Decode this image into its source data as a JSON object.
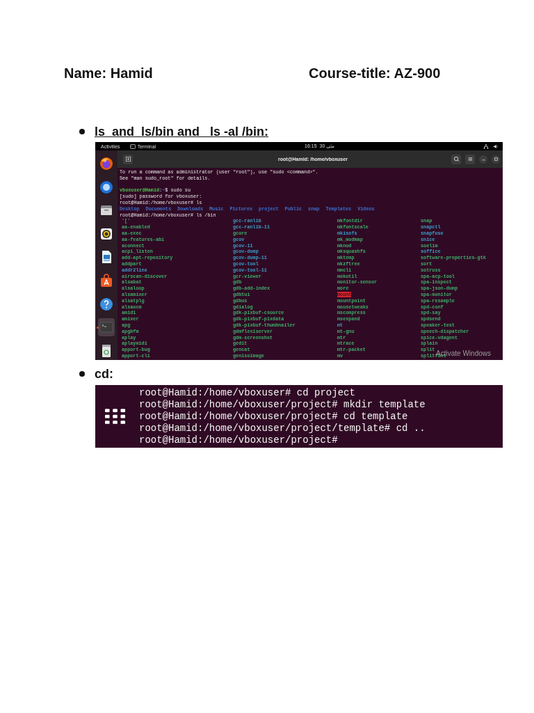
{
  "header": {
    "name": "Name: Hamid",
    "course": "Course-title: AZ-900"
  },
  "section_1": {
    "heading": "ls  and  ls/bin and   ls -al /bin:",
    "underlined": true,
    "desktop": {
      "topbar": {
        "activities": "Activities",
        "app": "Terminal",
        "time": "16:15",
        "date": "30 مئی"
      },
      "dock": [
        {
          "kind": "browser",
          "running": false
        },
        {
          "kind": "mail",
          "running": false
        },
        {
          "kind": "files",
          "running": false
        },
        {
          "kind": "music",
          "running": false
        },
        {
          "kind": "writer",
          "running": false
        },
        {
          "kind": "store",
          "running": false
        },
        {
          "kind": "help",
          "running": false
        },
        {
          "kind": "terminal",
          "running": true
        },
        {
          "kind": "trash",
          "running": false
        }
      ],
      "terminal": {
        "title": "root@Hamid: /home/vboxuser",
        "lines": [
          {
            "kind": "text",
            "segments": [
              {
                "t": "To run a command as administrator (user \"root\"), use \"sudo <command>\".",
                "kind": "plain"
              }
            ]
          },
          {
            "kind": "text",
            "segments": [
              {
                "t": "See \"man sudo_root\" for details.",
                "kind": "plain"
              }
            ]
          },
          {
            "kind": "blank"
          },
          {
            "kind": "text",
            "segments": [
              {
                "t": "vboxuser@Hamid",
                "kind": "user"
              },
              {
                "t": ":",
                "kind": "plain"
              },
              {
                "t": "~",
                "kind": "path"
              },
              {
                "t": "$ sudo su",
                "kind": "plain"
              }
            ]
          },
          {
            "kind": "text",
            "segments": [
              {
                "t": "[sudo] password for vboxuser:",
                "kind": "plain"
              }
            ]
          },
          {
            "kind": "text",
            "segments": [
              {
                "t": "root@Hamid:/home/vboxuser# ls",
                "kind": "plain"
              }
            ]
          },
          {
            "kind": "text",
            "segments": [
              {
                "t": "Desktop",
                "kind": "dir"
              },
              {
                "t": "Documents",
                "kind": "dir"
              },
              {
                "t": "Downloads",
                "kind": "dir"
              },
              {
                "t": "Music",
                "kind": "dir"
              },
              {
                "t": "Pictures",
                "kind": "dir"
              },
              {
                "t": "project",
                "kind": "dir"
              },
              {
                "t": "Public",
                "kind": "dir"
              },
              {
                "t": "snap",
                "kind": "dir"
              },
              {
                "t": "Templates",
                "kind": "dir"
              },
              {
                "t": "Videos",
                "kind": "dir"
              }
            ]
          },
          {
            "kind": "text",
            "segments": [
              {
                "t": "root@Hamid:/home/vboxuser# ls /bin",
                "kind": "plain"
              }
            ]
          }
        ],
        "columns": [
          [
            {
              "t": "'['",
              "kind": "exec"
            },
            {
              "t": "aa-enabled",
              "kind": "exec"
            },
            {
              "t": "aa-exec",
              "kind": "exec"
            },
            {
              "t": "aa-features-abi",
              "kind": "exec"
            },
            {
              "t": "aconnect",
              "kind": "exec"
            },
            {
              "t": "acpi_listen",
              "kind": "exec"
            },
            {
              "t": "add-apt-repository",
              "kind": "exec"
            },
            {
              "t": "addpart",
              "kind": "exec"
            },
            {
              "t": "addr2line",
              "kind": "link"
            },
            {
              "t": "airscan-discover",
              "kind": "exec"
            },
            {
              "t": "alsabat",
              "kind": "exec"
            },
            {
              "t": "alsaloop",
              "kind": "exec"
            },
            {
              "t": "alsamixer",
              "kind": "exec"
            },
            {
              "t": "alsatplg",
              "kind": "exec"
            },
            {
              "t": "alsaucm",
              "kind": "exec"
            },
            {
              "t": "amidi",
              "kind": "exec"
            },
            {
              "t": "amixer",
              "kind": "exec"
            },
            {
              "t": "apg",
              "kind": "exec"
            },
            {
              "t": "apgbfm",
              "kind": "exec"
            },
            {
              "t": "aplay",
              "kind": "exec"
            },
            {
              "t": "aplaymidi",
              "kind": "exec"
            },
            {
              "t": "apport-bug",
              "kind": "exec"
            },
            {
              "t": "apport-cli",
              "kind": "exec"
            }
          ],
          [
            {
              "t": "gcc-ranlib",
              "kind": "link"
            },
            {
              "t": "gcc-ranlib-11",
              "kind": "link"
            },
            {
              "t": "gcore",
              "kind": "exec"
            },
            {
              "t": "gcov",
              "kind": "link"
            },
            {
              "t": "gcov-11",
              "kind": "link"
            },
            {
              "t": "gcov-dump",
              "kind": "link"
            },
            {
              "t": "gcov-dump-11",
              "kind": "link"
            },
            {
              "t": "gcov-tool",
              "kind": "link"
            },
            {
              "t": "gcov-tool-11",
              "kind": "link"
            },
            {
              "t": "gcr-viewer",
              "kind": "exec"
            },
            {
              "t": "gdb",
              "kind": "exec"
            },
            {
              "t": "gdb-add-index",
              "kind": "exec"
            },
            {
              "t": "gdbtui",
              "kind": "exec"
            },
            {
              "t": "gdbus",
              "kind": "exec"
            },
            {
              "t": "gdialog",
              "kind": "exec"
            },
            {
              "t": "gdk-pixbuf-csource",
              "kind": "exec"
            },
            {
              "t": "gdk-pixbuf-pixdata",
              "kind": "exec"
            },
            {
              "t": "gdk-pixbuf-thumbnailer",
              "kind": "exec"
            },
            {
              "t": "gdmflexiserver",
              "kind": "exec"
            },
            {
              "t": "gdm-screenshot",
              "kind": "exec"
            },
            {
              "t": "gedit",
              "kind": "exec"
            },
            {
              "t": "gencat",
              "kind": "exec"
            },
            {
              "t": "genisoimage",
              "kind": "exec"
            }
          ],
          [
            {
              "t": "mkfontdir",
              "kind": "exec"
            },
            {
              "t": "mkfontscale",
              "kind": "exec"
            },
            {
              "t": "mkisofs",
              "kind": "link"
            },
            {
              "t": "mk_modmap",
              "kind": "exec"
            },
            {
              "t": "mknod",
              "kind": "exec"
            },
            {
              "t": "mksquashfs",
              "kind": "exec"
            },
            {
              "t": "mktemp",
              "kind": "exec"
            },
            {
              "t": "mkzftree",
              "kind": "exec"
            },
            {
              "t": "mmcli",
              "kind": "exec"
            },
            {
              "t": "mokutil",
              "kind": "exec"
            },
            {
              "t": "monitor-sensor",
              "kind": "exec"
            },
            {
              "t": "more",
              "kind": "exec"
            },
            {
              "t": "mount",
              "kind": "setuid"
            },
            {
              "t": "mountpoint",
              "kind": "exec"
            },
            {
              "t": "mousetweaks",
              "kind": "exec"
            },
            {
              "t": "mscompress",
              "kind": "exec"
            },
            {
              "t": "msexpand",
              "kind": "exec"
            },
            {
              "t": "mt",
              "kind": "link"
            },
            {
              "t": "mt-gnu",
              "kind": "exec"
            },
            {
              "t": "mtr",
              "kind": "exec"
            },
            {
              "t": "mtrace",
              "kind": "exec"
            },
            {
              "t": "mtr-packet",
              "kind": "exec"
            },
            {
              "t": "mv",
              "kind": "exec"
            }
          ],
          [
            {
              "t": "snap",
              "kind": "exec"
            },
            {
              "t": "snapctl",
              "kind": "link"
            },
            {
              "t": "snapfuse",
              "kind": "link"
            },
            {
              "t": "snice",
              "kind": "link"
            },
            {
              "t": "soelim",
              "kind": "exec"
            },
            {
              "t": "soffice",
              "kind": "link"
            },
            {
              "t": "software-properties-gtk",
              "kind": "exec"
            },
            {
              "t": "sort",
              "kind": "exec"
            },
            {
              "t": "sotruss",
              "kind": "exec"
            },
            {
              "t": "spa-acp-tool",
              "kind": "exec"
            },
            {
              "t": "spa-inspect",
              "kind": "exec"
            },
            {
              "t": "spa-json-dump",
              "kind": "exec"
            },
            {
              "t": "spa-monitor",
              "kind": "exec"
            },
            {
              "t": "spa-resample",
              "kind": "exec"
            },
            {
              "t": "spd-conf",
              "kind": "exec"
            },
            {
              "t": "spd-say",
              "kind": "exec"
            },
            {
              "t": "spdsend",
              "kind": "exec"
            },
            {
              "t": "speaker-test",
              "kind": "exec"
            },
            {
              "t": "speech-dispatcher",
              "kind": "exec"
            },
            {
              "t": "spice-vdagent",
              "kind": "exec"
            },
            {
              "t": "splain",
              "kind": "exec"
            },
            {
              "t": "split",
              "kind": "exec"
            },
            {
              "t": "splitfont",
              "kind": "exec"
            }
          ]
        ]
      },
      "overlay_text": "Activate Windows"
    }
  },
  "section_2": {
    "heading": "cd:",
    "underlined": false,
    "terminal": {
      "lines": [
        "root@Hamid:/home/vboxuser# cd project",
        "root@Hamid:/home/vboxuser/project# mkdir template",
        "root@Hamid:/home/vboxuser/project# cd template",
        "root@Hamid:/home/vboxuser/project/template# cd ..",
        "root@Hamid:/home/vboxuser/project#"
      ]
    }
  }
}
